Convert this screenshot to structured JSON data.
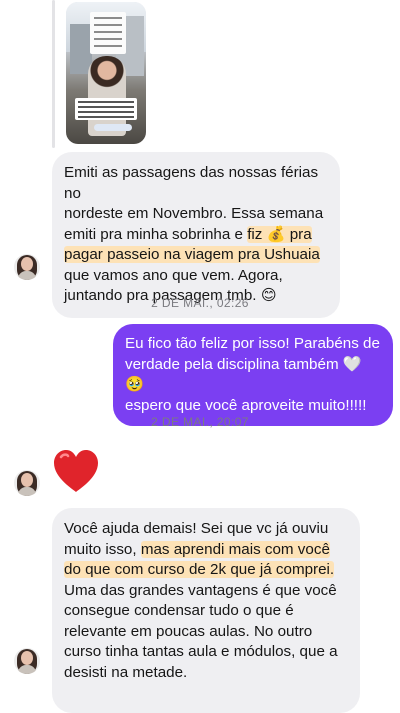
{
  "messages": {
    "msg1_lines": [
      "Emiti as passagens das nossas férias no",
      "nordeste em Novembro. Essa semana",
      "emiti pra minha sobrinha e ",
      "fiz 💰 pra",
      "pagar passeio na viagem pra Ushuaia",
      "que vamos ano que vem. Agora,",
      "juntando pra passagem tmb. 😊"
    ],
    "timestamp1": "2 DE MAI., 02:26",
    "msg2_lines": [
      "Eu fico tão feliz por isso! Parabéns de",
      "verdade pela disciplina também 🤍 🥹",
      "espero que você aproveite muito!!!!!"
    ],
    "timestamp2": "2 DE MAI., 20:07",
    "msg3_emoji": "heart",
    "msg4_lines": [
      "Você ajuda demais! Sei que vc já ouviu",
      "muito isso, ",
      "mas aprendi mais com você",
      "do que com curso de 2k que já comprei.",
      "Uma das grandes vantagens é que você",
      "consegue condensar tudo o que é",
      "relevante em poucas aulas. No outro",
      "curso tinha tantas aula e módulos, que a",
      "desisti na metade."
    ]
  },
  "colors": {
    "incoming_bubble": "#efeff2",
    "outgoing_bubble": "#7b3ff2",
    "highlight": "#fde2b6",
    "heart": "#e0242b"
  },
  "icons": {
    "avatar": "profile-photo",
    "story": "story-reply-thumbnail"
  }
}
